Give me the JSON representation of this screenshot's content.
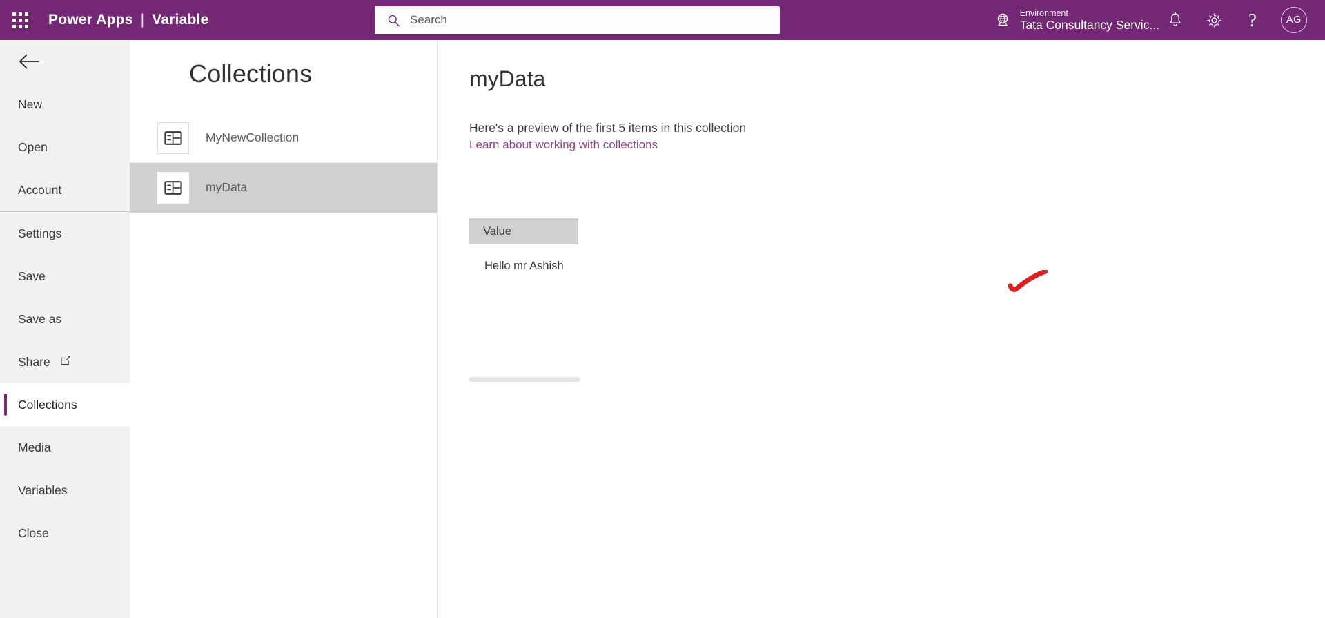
{
  "topbar": {
    "waffle_icon": "app-launcher-waffle-icon",
    "product_name": "Power Apps",
    "separator": "|",
    "app_name": "Variable",
    "search": {
      "icon": "search-icon",
      "placeholder": "Search",
      "value": ""
    },
    "environment": {
      "icon": "globe-environment-icon",
      "label": "Environment",
      "name": "Tata Consultancy Servic..."
    },
    "icons": [
      {
        "name": "notifications-bell-icon",
        "glyph": "bell"
      },
      {
        "name": "settings-gear-icon",
        "glyph": "gear"
      },
      {
        "name": "help-question-icon",
        "glyph": "?"
      }
    ],
    "avatar_initials": "AG",
    "background_color": "#742774"
  },
  "rail": {
    "back_icon": "back-arrow-icon",
    "items": [
      {
        "label": "New",
        "selected": false
      },
      {
        "label": "Open",
        "selected": false
      },
      {
        "label": "Account",
        "selected": false
      },
      {
        "label": "Settings",
        "selected": false
      },
      {
        "label": "Save",
        "selected": false
      },
      {
        "label": "Save as",
        "selected": false
      },
      {
        "label": "Share",
        "selected": false,
        "trailing_icon": "open-in-new-window-icon"
      },
      {
        "label": "Collections",
        "selected": true
      },
      {
        "label": "Media",
        "selected": false
      },
      {
        "label": "Variables",
        "selected": false
      },
      {
        "label": "Close",
        "selected": false
      }
    ],
    "accent_color": "#742774",
    "background_color": "#f2f1f0"
  },
  "list_panel": {
    "title": "Collections",
    "items": [
      {
        "name": "MyNewCollection",
        "icon": "collection-table-icon",
        "selected": false
      },
      {
        "name": "myData",
        "icon": "collection-table-icon",
        "selected": true
      }
    ]
  },
  "detail": {
    "title": "myData",
    "preview_note": "Here's a preview of the first 5 items in this collection",
    "learn_link": "Learn about working with collections",
    "link_color": "#8e4585",
    "table": {
      "columns": [
        "Value"
      ],
      "rows": [
        [
          "Hello mr Ashish"
        ]
      ]
    },
    "annotation": {
      "name": "red-handdrawn-checkmark",
      "color": "#e02020"
    }
  }
}
